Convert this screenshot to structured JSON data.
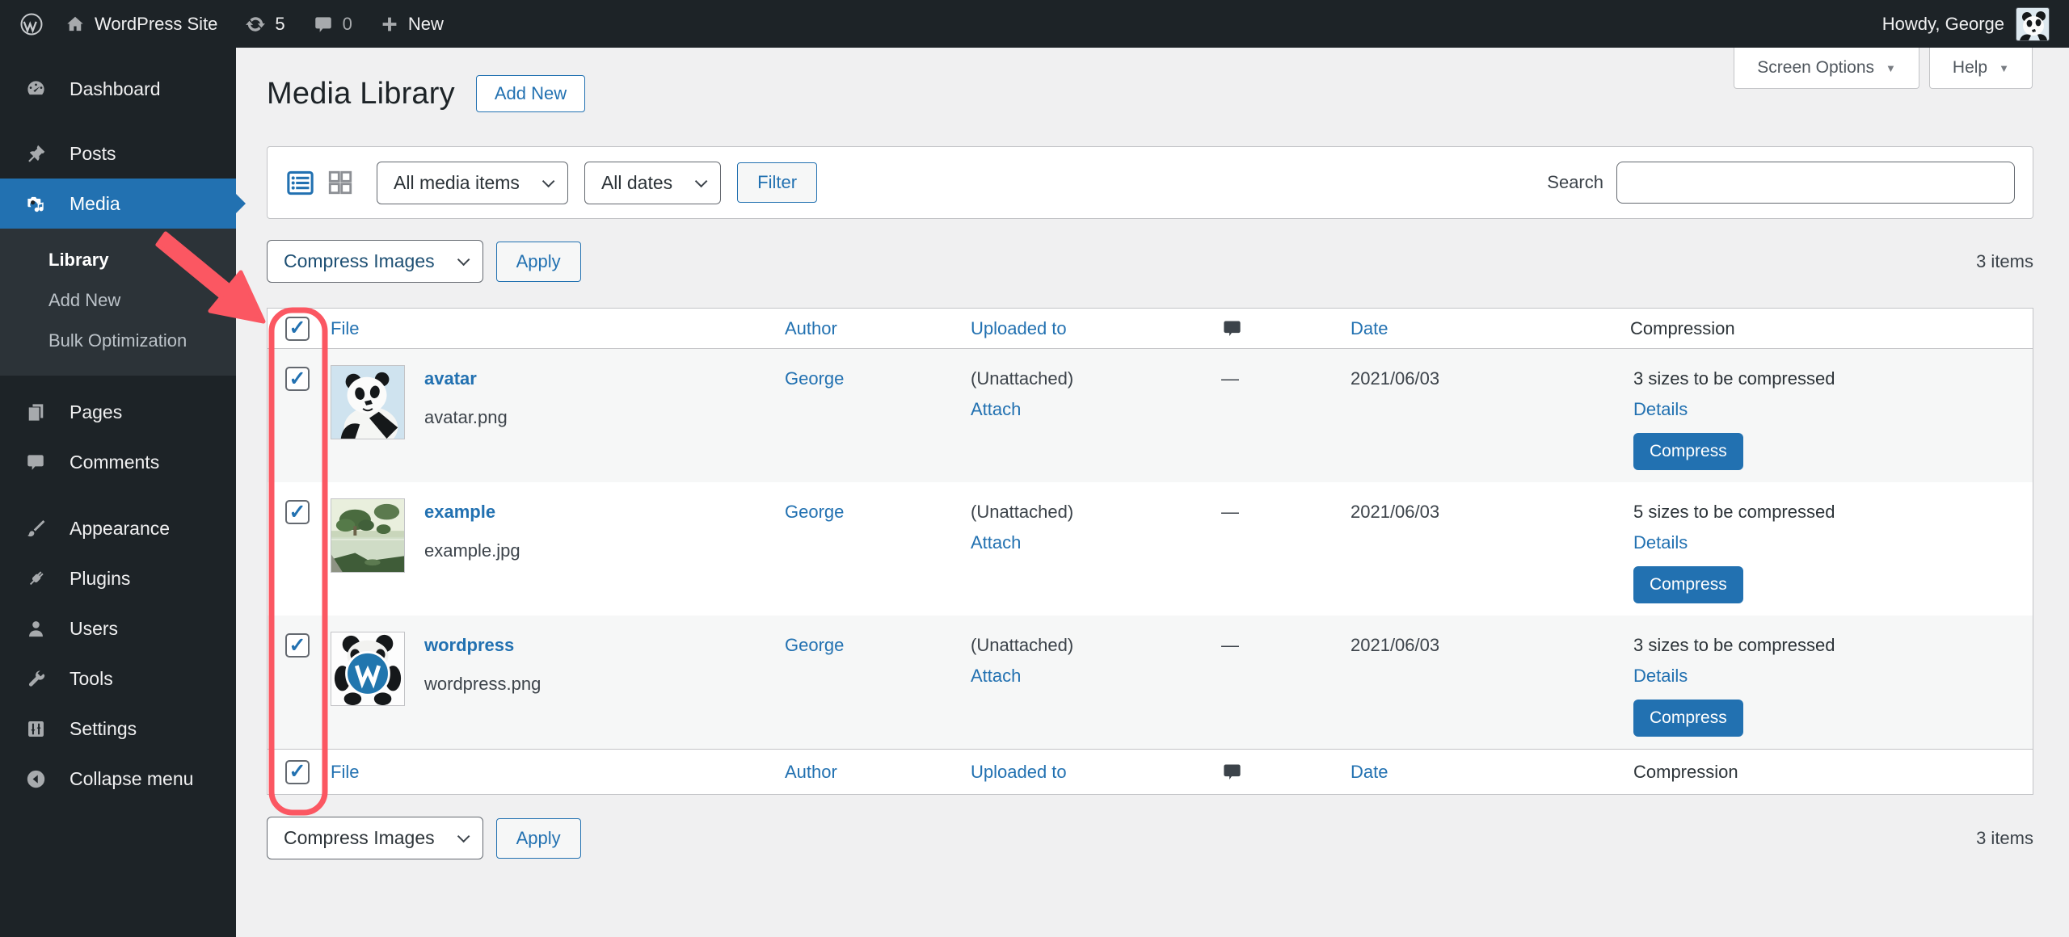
{
  "colors": {
    "accent": "#2271b1",
    "annotation_red": "#fb5762",
    "admin_bar_bg": "#1d2327",
    "submenu_bg": "#2c3338",
    "page_bg": "#f0f0f1",
    "row_alt_bg": "#f6f7f7",
    "border": "#c3c4c7",
    "compress_button_bg": "#2271b1"
  },
  "icons": {
    "check": "✓",
    "caret_down": "▼"
  },
  "admin_bar": {
    "site_name": "WordPress Site",
    "updates_count": "5",
    "comments_count": "0",
    "new_label": "New",
    "howdy": "Howdy, George"
  },
  "sidebar": {
    "items": [
      {
        "label": "Dashboard",
        "icon": "dashboard-icon"
      },
      {
        "label": "Posts",
        "icon": "pin-icon"
      },
      {
        "label": "Media",
        "icon": "media-icon",
        "active": true
      },
      {
        "label": "Pages",
        "icon": "pages-icon"
      },
      {
        "label": "Comments",
        "icon": "comment-icon"
      },
      {
        "label": "Appearance",
        "icon": "brush-icon"
      },
      {
        "label": "Plugins",
        "icon": "plug-icon"
      },
      {
        "label": "Users",
        "icon": "user-icon"
      },
      {
        "label": "Tools",
        "icon": "wrench-icon"
      },
      {
        "label": "Settings",
        "icon": "sliders-icon"
      }
    ],
    "media_submenu": {
      "library": "Library",
      "add_new": "Add New",
      "bulk_optimization": "Bulk Optimization"
    },
    "collapse": "Collapse menu"
  },
  "page": {
    "title": "Media Library",
    "add_new": "Add New",
    "screen_options": "Screen Options",
    "help": "Help"
  },
  "filters": {
    "media_type": "All media items",
    "date": "All dates",
    "filter_button": "Filter",
    "search_label": "Search",
    "search_value": "",
    "search_placeholder": ""
  },
  "bulk": {
    "action": "Compress Images",
    "apply": "Apply",
    "count": "3 items"
  },
  "table": {
    "headers": {
      "file": "File",
      "author": "Author",
      "uploaded_to": "Uploaded to",
      "date": "Date",
      "compression": "Compression"
    },
    "rows": [
      {
        "title": "avatar",
        "filename": "avatar.png",
        "author": "George",
        "uploaded_to": "(Unattached)",
        "attach": "Attach",
        "comments": "—",
        "date": "2021/06/03",
        "compression_status": "3 sizes to be compressed",
        "details": "Details",
        "compress": "Compress"
      },
      {
        "title": "example",
        "filename": "example.jpg",
        "author": "George",
        "uploaded_to": "(Unattached)",
        "attach": "Attach",
        "comments": "—",
        "date": "2021/06/03",
        "compression_status": "5 sizes to be compressed",
        "details": "Details",
        "compress": "Compress"
      },
      {
        "title": "wordpress",
        "filename": "wordpress.png",
        "author": "George",
        "uploaded_to": "(Unattached)",
        "attach": "Attach",
        "comments": "—",
        "date": "2021/06/03",
        "compression_status": "3 sizes to be compressed",
        "details": "Details",
        "compress": "Compress"
      }
    ]
  }
}
